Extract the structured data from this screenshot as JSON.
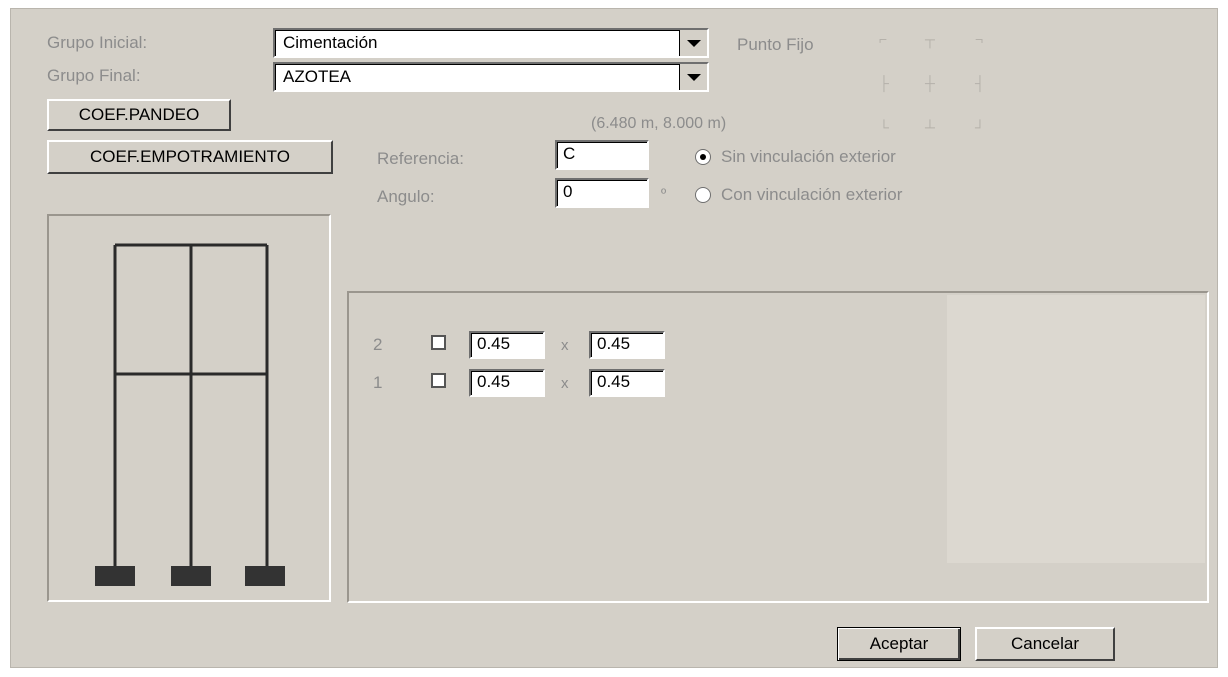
{
  "dialog": {
    "grupo_inicial_label": "Grupo Inicial:",
    "grupo_inicial_value": "Cimentación",
    "grupo_final_label": "Grupo Final:",
    "grupo_final_value": "AZOTEA",
    "punto_fijo_label": "Punto Fijo",
    "coordinates_text": "(6.480 m, 8.000 m)",
    "coef_pandeo_label": "COEF.PANDEO",
    "coef_empotramiento_label": "COEF.EMPOTRAMIENTO",
    "referencia_label": "Referencia:",
    "referencia_value": "C",
    "angulo_label": "Angulo:",
    "angulo_value": "0",
    "degree_symbol": "º",
    "radio_sin_label": "Sin vinculación exterior",
    "radio_con_label": "Con vinculación exterior",
    "sin_selected": true,
    "rows": [
      {
        "level": "2",
        "width": "0.45",
        "times": "x",
        "height": "0.45"
      },
      {
        "level": "1",
        "width": "0.45",
        "times": "x",
        "height": "0.45"
      }
    ],
    "accept_label": "Aceptar",
    "cancel_label": "Cancelar"
  },
  "colors": {
    "dialog_bg": "#d4d0c8",
    "frame_line": "#2a2a2a",
    "footing": "#333333"
  }
}
